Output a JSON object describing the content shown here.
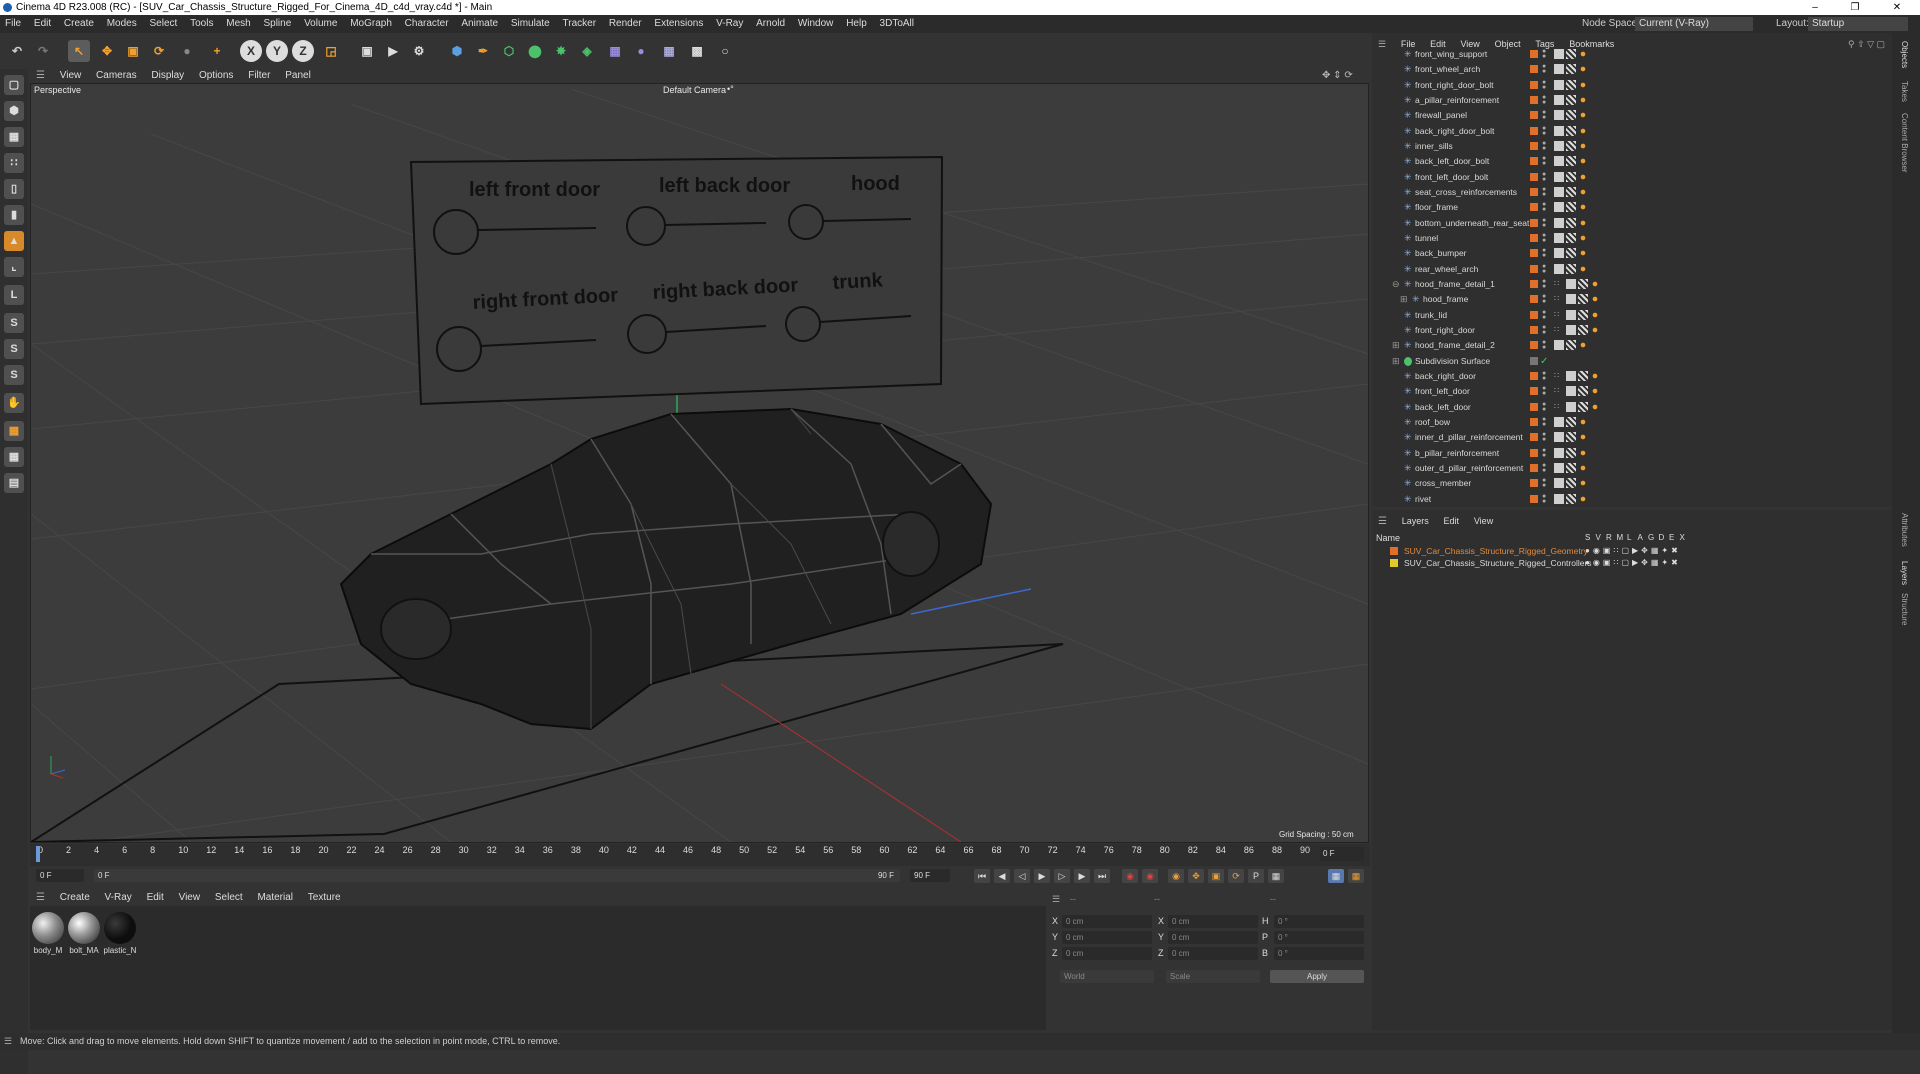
{
  "window": {
    "title": "Cinema 4D R23.008 (RC) - [SUV_Car_Chassis_Structure_Rigged_For_Cinema_4D_c4d_vray.c4d *] - Main",
    "minimize": "–",
    "maximize": "❐",
    "close": "✕"
  },
  "menu": [
    "File",
    "Edit",
    "Create",
    "Modes",
    "Select",
    "Tools",
    "Mesh",
    "Spline",
    "Volume",
    "MoGraph",
    "Character",
    "Animate",
    "Simulate",
    "Tracker",
    "Render",
    "Extensions",
    "V-Ray",
    "Arnold",
    "Window",
    "Help",
    "3DToAll"
  ],
  "nodespace": {
    "label": "Node Space:",
    "value": "Current (V-Ray)"
  },
  "layout": {
    "label": "Layout:",
    "value": "Startup"
  },
  "toolbar": {
    "x": "X",
    "y": "Y",
    "z": "Z"
  },
  "viewport": {
    "menu": [
      "View",
      "Cameras",
      "Display",
      "Options",
      "Filter",
      "Panel"
    ],
    "projection": "Perspective",
    "camera": "Default Camera",
    "camera_suffix": "•°",
    "grid_spacing": "Grid Spacing : 50 cm",
    "rig_labels": {
      "lfd": "left front door",
      "lbd": "left back door",
      "hood": "hood",
      "rfd": "right front door",
      "rbd": "right back door",
      "trunk": "trunk"
    }
  },
  "timeline": {
    "ticks": [
      "0",
      "2",
      "4",
      "6",
      "8",
      "10",
      "12",
      "14",
      "16",
      "18",
      "20",
      "22",
      "24",
      "26",
      "28",
      "30",
      "32",
      "34",
      "36",
      "38",
      "40",
      "42",
      "44",
      "46",
      "48",
      "50",
      "52",
      "54",
      "56",
      "58",
      "60",
      "62",
      "64",
      "66",
      "68",
      "70",
      "72",
      "74",
      "76",
      "78",
      "80",
      "82",
      "84",
      "86",
      "88",
      "90"
    ],
    "current_frame": "0 F",
    "start": "0 F",
    "range_start": "0 F",
    "range_end": "90 F",
    "end": "90 F"
  },
  "materials": {
    "menu": [
      "Create",
      "V-Ray",
      "Edit",
      "View",
      "Select",
      "Material",
      "Texture"
    ],
    "items": [
      {
        "label": "body_M",
        "color": "#8a8a8a"
      },
      {
        "label": "bolt_MA",
        "color": "#9a9a9a"
      },
      {
        "label": "plastic_N",
        "color": "#0d0d0d"
      }
    ]
  },
  "coords": {
    "header": [
      "--",
      "--",
      "--"
    ],
    "rows": [
      {
        "a": "X",
        "av": "0 cm",
        "b": "X",
        "bv": "0 cm",
        "c": "H",
        "cv": "0 °"
      },
      {
        "a": "Y",
        "av": "0 cm",
        "b": "Y",
        "bv": "0 cm",
        "c": "P",
        "cv": "0 °"
      },
      {
        "a": "Z",
        "av": "0 cm",
        "b": "Z",
        "bv": "0 cm",
        "c": "B",
        "cv": "0 °"
      }
    ],
    "mode": "World",
    "scale": "Scale",
    "apply": "Apply"
  },
  "objects": {
    "menu": [
      "File",
      "Edit",
      "View",
      "Object",
      "Tags",
      "Bookmarks"
    ],
    "rows": [
      {
        "name": "front_wing_support",
        "kind": "bone",
        "expand": ""
      },
      {
        "name": "front_wheel_arch",
        "kind": "bone",
        "expand": ""
      },
      {
        "name": "front_right_door_bolt",
        "kind": "bone",
        "expand": ""
      },
      {
        "name": "a_pillar_reinforcement",
        "kind": "bone",
        "expand": ""
      },
      {
        "name": "firewall_panel",
        "kind": "bone",
        "expand": ""
      },
      {
        "name": "back_right_door_bolt",
        "kind": "bone",
        "expand": ""
      },
      {
        "name": "inner_sills",
        "kind": "bone",
        "expand": ""
      },
      {
        "name": "back_left_door_bolt",
        "kind": "bone",
        "expand": ""
      },
      {
        "name": "front_left_door_bolt",
        "kind": "bone",
        "expand": ""
      },
      {
        "name": "seat_cross_reinforcements",
        "kind": "bone",
        "expand": ""
      },
      {
        "name": "floor_frame",
        "kind": "bone",
        "expand": ""
      },
      {
        "name": "bottom_underneath_rear_seat",
        "kind": "bone",
        "expand": ""
      },
      {
        "name": "tunnel",
        "kind": "bone",
        "expand": ""
      },
      {
        "name": "back_bumper",
        "kind": "bone",
        "expand": ""
      },
      {
        "name": "rear_wheel_arch",
        "kind": "bone",
        "expand": ""
      },
      {
        "name": "hood_frame_detail_1",
        "kind": "bone",
        "expand": "⊖"
      },
      {
        "name": "hood_frame",
        "kind": "bone",
        "expand": "⊞",
        "indent": 1
      },
      {
        "name": "trunk_lid",
        "kind": "bone",
        "expand": ""
      },
      {
        "name": "front_right_door",
        "kind": "bone",
        "expand": ""
      },
      {
        "name": "hood_frame_detail_2",
        "kind": "bone",
        "expand": "⊞"
      },
      {
        "name": "Subdivision Surface",
        "kind": "subdiv",
        "expand": "⊞"
      },
      {
        "name": "back_right_door",
        "kind": "bone",
        "expand": ""
      },
      {
        "name": "front_left_door",
        "kind": "bone",
        "expand": ""
      },
      {
        "name": "back_left_door",
        "kind": "bone",
        "expand": ""
      },
      {
        "name": "roof_bow",
        "kind": "bone",
        "expand": ""
      },
      {
        "name": "inner_d_pillar_reinforcement",
        "kind": "bone",
        "expand": ""
      },
      {
        "name": "b_pillar_reinforcement",
        "kind": "bone",
        "expand": ""
      },
      {
        "name": "outer_d_pillar_reinforcement",
        "kind": "bone",
        "expand": ""
      },
      {
        "name": "cross_member",
        "kind": "bone",
        "expand": ""
      },
      {
        "name": "rivet",
        "kind": "bone",
        "expand": ""
      }
    ]
  },
  "layers": {
    "menu": [
      "Layers",
      "Edit",
      "View"
    ],
    "header_name": "Name",
    "header_flags": [
      "S",
      "V",
      "R",
      "M",
      "L",
      "A",
      "G",
      "D",
      "E",
      "X"
    ],
    "rows": [
      {
        "name": "SUV_Car_Chassis_Structure_Rigged_Geometry",
        "color": "#e06f2a",
        "text_color": "#e58a3a"
      },
      {
        "name": "SUV_Car_Chassis_Structure_Rigged_Controllers",
        "color": "#e0c92a",
        "text_color": "#d8d8d8"
      }
    ]
  },
  "side_tabs": [
    "Objects",
    "Takes",
    "Content Browser",
    "Attributes",
    "Layers",
    "Structure"
  ],
  "status": "Move: Click and drag to move elements. Hold down SHIFT to quantize movement / add to the selection in point mode, CTRL to remove."
}
